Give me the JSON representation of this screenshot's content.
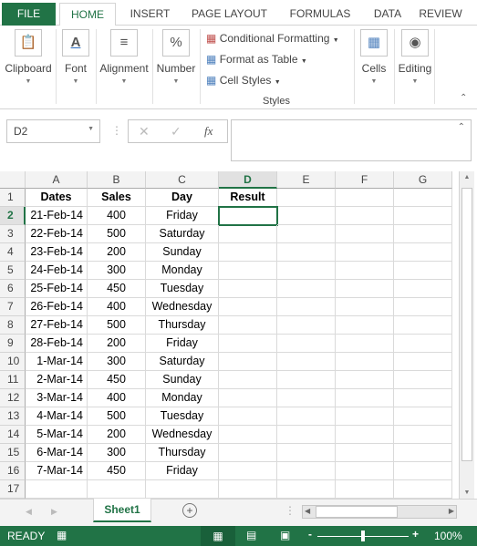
{
  "ribbon_tabs": [
    "FILE",
    "HOME",
    "INSERT",
    "PAGE LAYOUT",
    "FORMULAS",
    "DATA",
    "REVIEW"
  ],
  "ribbon_groups": {
    "clipboard": "Clipboard",
    "font": "Font",
    "alignment": "Alignment",
    "number": "Number",
    "styles": "Styles",
    "cells": "Cells",
    "editing": "Editing"
  },
  "styles_items": [
    "Conditional Formatting",
    "Format as Table",
    "Cell Styles"
  ],
  "formula_bar": {
    "name_box": "D2",
    "fx": "fx",
    "value": ""
  },
  "columns": [
    "A",
    "B",
    "C",
    "D",
    "E",
    "F",
    "G"
  ],
  "rows": [
    [
      "Dates",
      "Sales",
      "Day",
      "Result"
    ],
    [
      "21-Feb-14",
      "400",
      "Friday",
      ""
    ],
    [
      "22-Feb-14",
      "500",
      "Saturday",
      ""
    ],
    [
      "23-Feb-14",
      "200",
      "Sunday",
      ""
    ],
    [
      "24-Feb-14",
      "300",
      "Monday",
      ""
    ],
    [
      "25-Feb-14",
      "450",
      "Tuesday",
      ""
    ],
    [
      "26-Feb-14",
      "400",
      "Wednesday",
      ""
    ],
    [
      "27-Feb-14",
      "500",
      "Thursday",
      ""
    ],
    [
      "28-Feb-14",
      "200",
      "Friday",
      ""
    ],
    [
      "1-Mar-14",
      "300",
      "Saturday",
      ""
    ],
    [
      "2-Mar-14",
      "450",
      "Sunday",
      ""
    ],
    [
      "3-Mar-14",
      "400",
      "Monday",
      ""
    ],
    [
      "4-Mar-14",
      "500",
      "Tuesday",
      ""
    ],
    [
      "5-Mar-14",
      "200",
      "Wednesday",
      ""
    ],
    [
      "6-Mar-14",
      "300",
      "Thursday",
      ""
    ],
    [
      "7-Mar-14",
      "450",
      "Friday",
      ""
    ],
    [
      "",
      "",
      "",
      ""
    ]
  ],
  "active_cell": "D2",
  "sheet_tabs": [
    "Sheet1"
  ],
  "status": {
    "mode": "READY",
    "zoom": "100%",
    "zoom_level": 100
  },
  "colors": {
    "accent": "#217346"
  }
}
